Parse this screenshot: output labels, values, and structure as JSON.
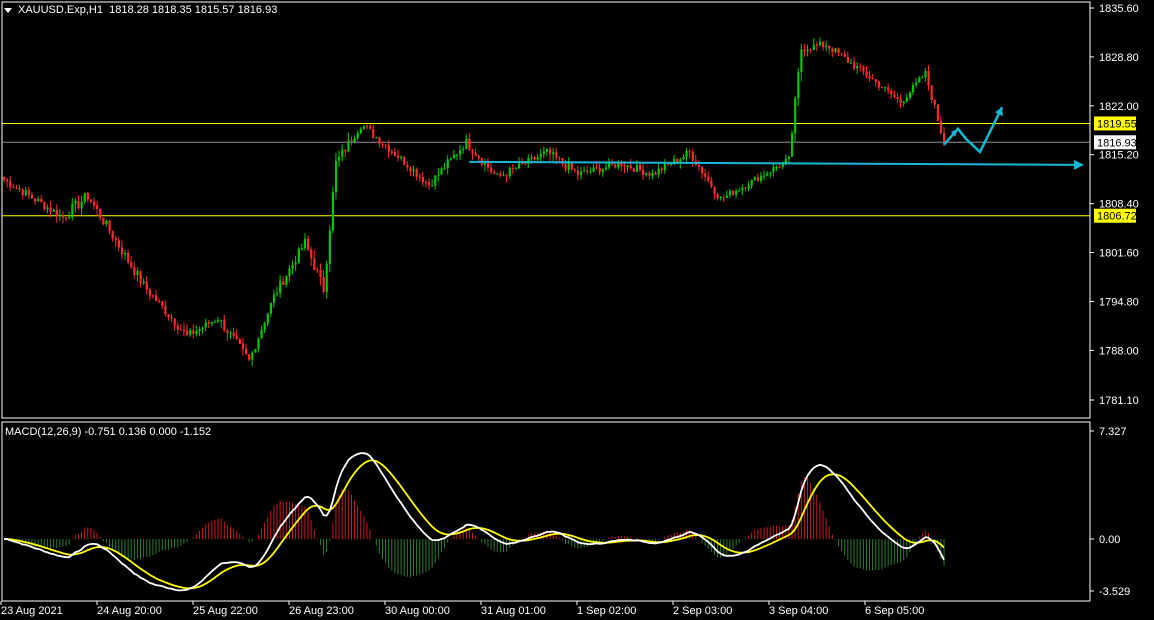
{
  "header": {
    "symbol": "XAUUSD.Exp,H1",
    "ohlc": "1818.28 1818.35 1815.57 1816.93"
  },
  "colors": {
    "bull": "#00c800",
    "bear": "#ff2a2a",
    "level": "#ffff00",
    "macd_line": "#ffffff",
    "signal_line": "#ffff00",
    "hist_up": "#c81e1e",
    "hist_down": "#2e7d32",
    "arrow": "#17b8d6",
    "axis": "#ffffff"
  },
  "chart_data": [
    {
      "type": "candlestick",
      "price_ticks": [
        "1835.60",
        "1828.80",
        "1822.00",
        "1815.20",
        "1808.40",
        "1801.60",
        "1794.80",
        "1788.00",
        "1781.10"
      ],
      "ylim": [
        1778.5,
        1837.6
      ],
      "levels": [
        {
          "value": 1819.55,
          "label": "1819.55",
          "style": "level"
        },
        {
          "value": 1806.72,
          "label": "1806.72",
          "style": "level"
        },
        {
          "value": 1816.93,
          "label": "1816.93",
          "style": "current"
        }
      ],
      "x_labels": [
        "23 Aug 2021",
        "24 Aug 20:00",
        "25 Aug 22:00",
        "26 Aug 23:00",
        "30 Aug 00:00",
        "31 Aug 01:00",
        "1 Sep 02:00",
        "2 Sep 03:00",
        "3 Sep 04:00",
        "6 Sep 05:00"
      ],
      "segments": [
        {
          "n": 20,
          "start": 1812.0,
          "end": 1806.5,
          "amp": 1.0
        },
        {
          "n": 8,
          "start": 1806.5,
          "end": 1809.5,
          "amp": 1.4
        },
        {
          "n": 18,
          "start": 1809.5,
          "end": 1797.0,
          "amp": 1.2
        },
        {
          "n": 14,
          "start": 1797.0,
          "end": 1790.0,
          "amp": 1.1
        },
        {
          "n": 10,
          "start": 1790.0,
          "end": 1792.5,
          "amp": 1.0
        },
        {
          "n": 10,
          "start": 1792.5,
          "end": 1786.5,
          "amp": 1.2
        },
        {
          "n": 8,
          "start": 1786.5,
          "end": 1795.5,
          "amp": 1.0
        },
        {
          "n": 10,
          "start": 1795.5,
          "end": 1803.0,
          "amp": 1.1
        },
        {
          "n": 6,
          "start": 1803.0,
          "end": 1796.5,
          "amp": 1.3
        },
        {
          "n": 4,
          "start": 1796.5,
          "end": 1814.0,
          "amp": 1.5
        },
        {
          "n": 8,
          "start": 1814.0,
          "end": 1819.5,
          "amp": 1.2
        },
        {
          "n": 12,
          "start": 1819.5,
          "end": 1815.0,
          "amp": 1.0
        },
        {
          "n": 10,
          "start": 1815.0,
          "end": 1811.0,
          "amp": 0.9
        },
        {
          "n": 12,
          "start": 1811.0,
          "end": 1817.0,
          "amp": 1.0
        },
        {
          "n": 10,
          "start": 1817.0,
          "end": 1812.0,
          "amp": 1.2
        },
        {
          "n": 16,
          "start": 1812.0,
          "end": 1815.5,
          "amp": 1.0
        },
        {
          "n": 10,
          "start": 1815.5,
          "end": 1812.5,
          "amp": 1.1
        },
        {
          "n": 14,
          "start": 1812.5,
          "end": 1814.0,
          "amp": 0.9
        },
        {
          "n": 10,
          "start": 1814.0,
          "end": 1812.5,
          "amp": 1.0
        },
        {
          "n": 12,
          "start": 1812.5,
          "end": 1815.5,
          "amp": 1.0
        },
        {
          "n": 10,
          "start": 1815.5,
          "end": 1809.0,
          "amp": 1.0
        },
        {
          "n": 8,
          "start": 1809.0,
          "end": 1811.0,
          "amp": 0.8
        },
        {
          "n": 14,
          "start": 1811.0,
          "end": 1814.5,
          "amp": 0.8
        },
        {
          "n": 4,
          "start": 1814.5,
          "end": 1830.0,
          "amp": 1.5
        },
        {
          "n": 8,
          "start": 1830.0,
          "end": 1830.5,
          "amp": 1.0
        },
        {
          "n": 14,
          "start": 1830.5,
          "end": 1826.0,
          "amp": 0.9
        },
        {
          "n": 10,
          "start": 1826.0,
          "end": 1822.5,
          "amp": 0.8
        },
        {
          "n": 8,
          "start": 1822.5,
          "end": 1826.5,
          "amp": 0.8
        },
        {
          "n": 6,
          "start": 1826.5,
          "end": 1816.9,
          "amp": 1.0
        }
      ],
      "projection": {
        "points": [
          [
            1816.0,
            1818.8
          ],
          [
            1815.2,
            1821.8
          ]
        ],
        "target_line": 1814.0
      }
    },
    {
      "type": "macd",
      "params": "MACD(12,26,9)",
      "values": "-0.751 0.136 0.000 -1.152",
      "ticks": [
        "7.327",
        "0.00",
        "-3.529"
      ],
      "ylim": [
        -3.529,
        7.327
      ]
    }
  ]
}
